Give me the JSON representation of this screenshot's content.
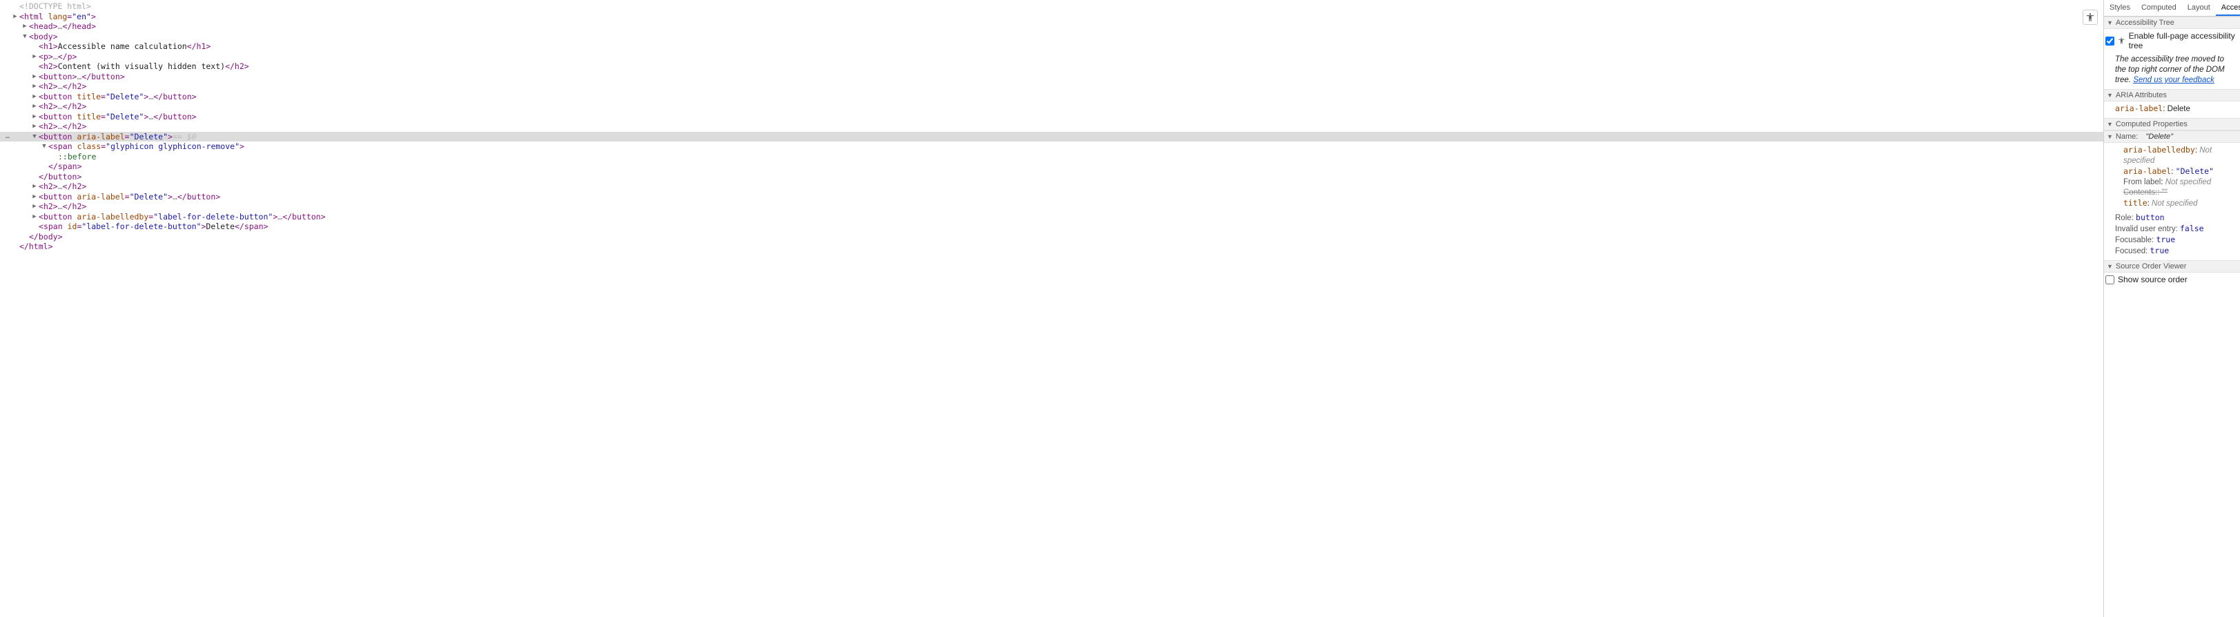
{
  "sidebar": {
    "tabs": [
      "Styles",
      "Computed",
      "Layout",
      "Accessibility"
    ],
    "active_tab": 3,
    "sections": {
      "a11y_tree": {
        "title": "Accessibility Tree",
        "checkbox_label": "Enable full-page accessibility tree",
        "checkbox_checked": true,
        "message_pre": "The accessibility tree moved to the top right corner of the DOM tree. ",
        "message_link": "Send us your feedback"
      },
      "aria_attrs": {
        "title": "ARIA Attributes",
        "rows": [
          {
            "key": "aria-label",
            "val": "Delete",
            "key_mono": true,
            "val_plain": true
          }
        ]
      },
      "computed_props": {
        "title": "Computed Properties",
        "name_header": {
          "label": "Name:",
          "value": "\"Delete\""
        },
        "name_sub": [
          {
            "key": "aria-labelledby",
            "val": "Not specified",
            "key_mono": true,
            "dim": true
          },
          {
            "key": "aria-label",
            "val": "\"Delete\"",
            "key_mono": true,
            "val_mono": true
          },
          {
            "key": "From label",
            "val": "Not specified",
            "dim": true
          },
          {
            "key": "Contents:",
            "val": "\"\"",
            "strike": true
          },
          {
            "key": "title",
            "val": "Not specified",
            "key_mono": true,
            "dim": true
          }
        ],
        "other": [
          {
            "key": "Role:",
            "val": "button",
            "val_mono": true
          },
          {
            "key": "Invalid user entry:",
            "val": "false",
            "val_mono": true
          },
          {
            "key": "Focusable:",
            "val": "true",
            "val_mono": true
          },
          {
            "key": "Focused:",
            "val": "true",
            "val_mono": true
          }
        ]
      },
      "source_order": {
        "title": "Source Order Viewer",
        "checkbox_label": "Show source order",
        "checkbox_checked": false
      }
    }
  },
  "dom": {
    "selected_marker": "…",
    "eqeq": "==",
    "dollar0": "$0",
    "lines": [
      {
        "depth": 0,
        "caret": "none",
        "tokens": [
          {
            "t": "doctype",
            "v": "<!DOCTYPE html>"
          }
        ]
      },
      {
        "depth": 0,
        "caret": "right",
        "tokens": [
          {
            "t": "open",
            "tag": "html",
            "attrs": [
              [
                "lang",
                "en"
              ]
            ]
          }
        ]
      },
      {
        "depth": 1,
        "caret": "right",
        "tokens": [
          {
            "t": "open",
            "tag": "head"
          },
          {
            "t": "ellipsis"
          },
          {
            "t": "close",
            "tag": "head"
          }
        ]
      },
      {
        "depth": 1,
        "caret": "down",
        "tokens": [
          {
            "t": "open",
            "tag": "body"
          }
        ]
      },
      {
        "depth": 2,
        "caret": "none",
        "tokens": [
          {
            "t": "open",
            "tag": "h1"
          },
          {
            "t": "text",
            "v": "Accessible name calculation"
          },
          {
            "t": "close",
            "tag": "h1"
          }
        ]
      },
      {
        "depth": 2,
        "caret": "right",
        "tokens": [
          {
            "t": "open",
            "tag": "p"
          },
          {
            "t": "ellipsis"
          },
          {
            "t": "close",
            "tag": "p"
          }
        ]
      },
      {
        "depth": 2,
        "caret": "none",
        "tokens": [
          {
            "t": "open",
            "tag": "h2"
          },
          {
            "t": "text",
            "v": "Content (with visually hidden text)"
          },
          {
            "t": "close",
            "tag": "h2"
          }
        ]
      },
      {
        "depth": 2,
        "caret": "right",
        "tokens": [
          {
            "t": "open",
            "tag": "button"
          },
          {
            "t": "ellipsis"
          },
          {
            "t": "close",
            "tag": "button"
          }
        ]
      },
      {
        "depth": 2,
        "caret": "right",
        "tokens": [
          {
            "t": "open",
            "tag": "h2"
          },
          {
            "t": "ellipsis"
          },
          {
            "t": "close",
            "tag": "h2"
          }
        ]
      },
      {
        "depth": 2,
        "caret": "right",
        "tokens": [
          {
            "t": "open",
            "tag": "button",
            "attrs": [
              [
                "title",
                "Delete"
              ]
            ]
          },
          {
            "t": "ellipsis"
          },
          {
            "t": "close",
            "tag": "button"
          }
        ]
      },
      {
        "depth": 2,
        "caret": "right",
        "tokens": [
          {
            "t": "open",
            "tag": "h2"
          },
          {
            "t": "ellipsis"
          },
          {
            "t": "close",
            "tag": "h2"
          }
        ]
      },
      {
        "depth": 2,
        "caret": "right",
        "tokens": [
          {
            "t": "open",
            "tag": "button",
            "attrs": [
              [
                "title",
                "Delete"
              ]
            ]
          },
          {
            "t": "ellipsis"
          },
          {
            "t": "close",
            "tag": "button"
          }
        ]
      },
      {
        "depth": 2,
        "caret": "right",
        "tokens": [
          {
            "t": "open",
            "tag": "h2"
          },
          {
            "t": "ellipsis"
          },
          {
            "t": "close",
            "tag": "h2"
          }
        ]
      },
      {
        "depth": 2,
        "caret": "down",
        "selected": true,
        "gutter": "…",
        "tokens": [
          {
            "t": "open",
            "tag": "button",
            "attrs": [
              [
                "aria-label",
                "Delete"
              ]
            ]
          },
          {
            "t": "eqdollar"
          }
        ]
      },
      {
        "depth": 3,
        "caret": "down",
        "tokens": [
          {
            "t": "open",
            "tag": "span",
            "attrs": [
              [
                "class",
                "glyphicon glyphicon-remove"
              ]
            ]
          }
        ]
      },
      {
        "depth": 4,
        "caret": "none",
        "tokens": [
          {
            "t": "pseudo",
            "v": "::before"
          }
        ]
      },
      {
        "depth": 3,
        "caret": "none",
        "tokens": [
          {
            "t": "close",
            "tag": "span"
          }
        ]
      },
      {
        "depth": 2,
        "caret": "none",
        "tokens": [
          {
            "t": "close",
            "tag": "button"
          }
        ]
      },
      {
        "depth": 2,
        "caret": "right",
        "tokens": [
          {
            "t": "open",
            "tag": "h2"
          },
          {
            "t": "ellipsis"
          },
          {
            "t": "close",
            "tag": "h2"
          }
        ]
      },
      {
        "depth": 2,
        "caret": "right",
        "tokens": [
          {
            "t": "open",
            "tag": "button",
            "attrs": [
              [
                "aria-label",
                "Delete"
              ]
            ]
          },
          {
            "t": "ellipsis"
          },
          {
            "t": "close",
            "tag": "button"
          }
        ]
      },
      {
        "depth": 2,
        "caret": "right",
        "tokens": [
          {
            "t": "open",
            "tag": "h2"
          },
          {
            "t": "ellipsis"
          },
          {
            "t": "close",
            "tag": "h2"
          }
        ]
      },
      {
        "depth": 2,
        "caret": "right",
        "tokens": [
          {
            "t": "open",
            "tag": "button",
            "attrs": [
              [
                "aria-labelledby",
                "label-for-delete-button"
              ]
            ]
          },
          {
            "t": "ellipsis"
          },
          {
            "t": "close",
            "tag": "button"
          }
        ]
      },
      {
        "depth": 2,
        "caret": "none",
        "tokens": [
          {
            "t": "open",
            "tag": "span",
            "attrs": [
              [
                "id",
                "label-for-delete-button"
              ]
            ]
          },
          {
            "t": "text",
            "v": "Delete"
          },
          {
            "t": "close",
            "tag": "span"
          }
        ]
      },
      {
        "depth": 1,
        "caret": "none",
        "tokens": [
          {
            "t": "close",
            "tag": "body"
          }
        ]
      },
      {
        "depth": 0,
        "caret": "none",
        "tokens": [
          {
            "t": "close",
            "tag": "html"
          }
        ]
      }
    ]
  }
}
